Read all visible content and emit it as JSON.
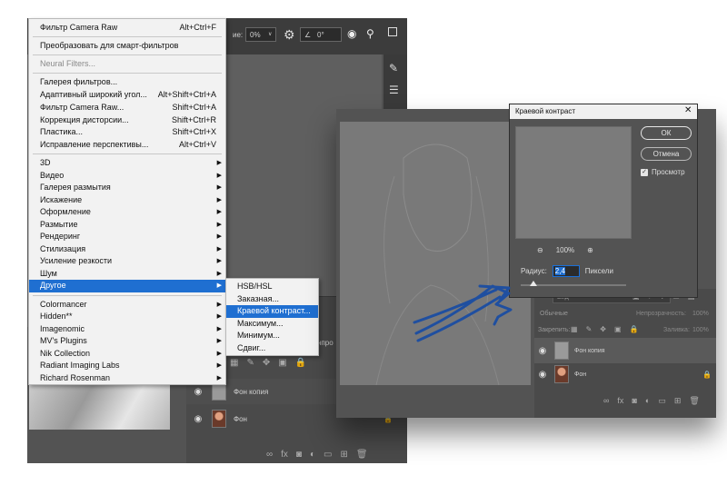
{
  "left_window": {
    "options": {
      "label_suffix": "ие:",
      "opacity_value": "0%",
      "angle_value": "0°"
    },
    "layers_label_fragment": "нпро",
    "layers": [
      {
        "name": "Фон копия"
      },
      {
        "name": "Фон"
      }
    ]
  },
  "filter_menu": {
    "items": [
      {
        "label": "Фильтр Camera Raw",
        "shortcut": "Alt+Ctrl+F"
      },
      {
        "label": "Преобразовать для смарт-фильтров"
      },
      {
        "label": "Neural Filters..."
      },
      {
        "label": "Галерея фильтров..."
      },
      {
        "label": "Адаптивный широкий угол...",
        "shortcut": "Alt+Shift+Ctrl+A"
      },
      {
        "label": "Фильтр Camera Raw...",
        "shortcut": "Shift+Ctrl+A"
      },
      {
        "label": "Коррекция дисторсии...",
        "shortcut": "Shift+Ctrl+R"
      },
      {
        "label": "Пластика...",
        "shortcut": "Shift+Ctrl+X"
      },
      {
        "label": "Исправление перспективы...",
        "shortcut": "Alt+Ctrl+V"
      },
      {
        "label": "3D"
      },
      {
        "label": "Видео"
      },
      {
        "label": "Галерея размытия"
      },
      {
        "label": "Искажение"
      },
      {
        "label": "Оформление"
      },
      {
        "label": "Размытие"
      },
      {
        "label": "Рендеринг"
      },
      {
        "label": "Стилизация"
      },
      {
        "label": "Усиление резкости"
      },
      {
        "label": "Шум"
      },
      {
        "label": "Другое"
      },
      {
        "label": "Colormancer"
      },
      {
        "label": "Hidden**"
      },
      {
        "label": "Imagenomic"
      },
      {
        "label": "MV's Plugins"
      },
      {
        "label": "Nik Collection"
      },
      {
        "label": "Radiant Imaging Labs"
      },
      {
        "label": "Richard Rosenman"
      }
    ]
  },
  "submenu": {
    "items": [
      {
        "label": "HSB/HSL"
      },
      {
        "label": "Заказная..."
      },
      {
        "label": "Краевой контраст..."
      },
      {
        "label": "Максимум..."
      },
      {
        "label": "Минимум..."
      },
      {
        "label": "Сдвиг..."
      }
    ]
  },
  "right_window": {
    "panel": {
      "search_placeholder": "Вид",
      "blend_mode": "Обычные",
      "opacity_label": "Непрозрачность:",
      "opacity_value": "100%",
      "lock_label": "Закрепить:",
      "fill_label": "Заливка:",
      "fill_value": "100%"
    },
    "layers": [
      {
        "name": "Фон копия"
      },
      {
        "name": "Фон"
      }
    ]
  },
  "dialog": {
    "title": "Краевой контраст",
    "ok_label": "ОК",
    "cancel_label": "Отмена",
    "preview_label": "Просмотр",
    "preview_checked": true,
    "zoom_value": "100%",
    "radius_label": "Радиус:",
    "radius_value": "2,4",
    "radius_unit": "Пиксели"
  },
  "colors": {
    "selection_blue": "#1f6fd1",
    "scribble_blue": "#1f4fa0",
    "ps_panel": "#535353"
  }
}
